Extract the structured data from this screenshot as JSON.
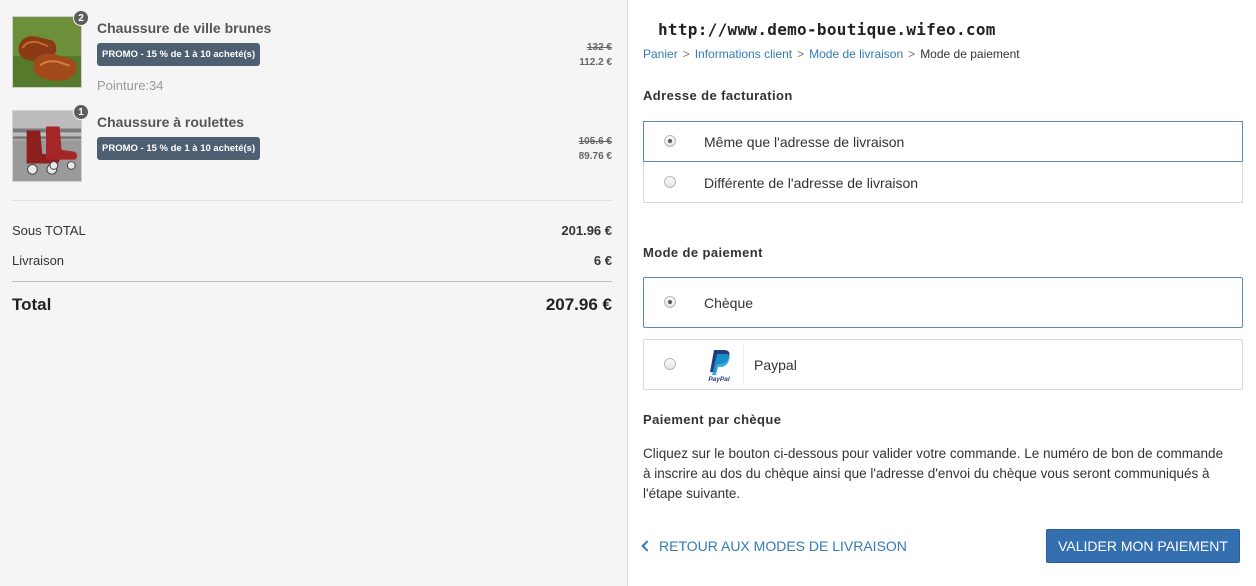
{
  "cart": {
    "items": [
      {
        "name": "Chaussure de ville brunes",
        "quantity": "2",
        "promo": "PROMO - 15 % de 1 à 10 acheté(s)",
        "size": "Pointure:34",
        "old_price": "132 €",
        "new_price": "112.2 €"
      },
      {
        "name": "Chaussure à roulettes",
        "quantity": "1",
        "promo": "PROMO - 15 % de 1 à 10 acheté(s)",
        "old_price": "105.6 €",
        "new_price": "89.76 €"
      }
    ],
    "subtotal_label": "Sous TOTAL",
    "subtotal_value": "201.96 €",
    "shipping_label": "Livraison",
    "shipping_value": "6 €",
    "total_label": "Total",
    "total_value": "207.96 €"
  },
  "header": {
    "site_url": "http://www.demo-boutique.wifeo.com"
  },
  "breadcrumb": {
    "items": [
      "Panier",
      "Informations client",
      "Mode de livraison",
      "Mode de paiement"
    ]
  },
  "billing": {
    "title": "Adresse de facturation",
    "options": [
      {
        "label": "Même que l'adresse de livraison",
        "selected": true
      },
      {
        "label": "Différente de l'adresse de livraison",
        "selected": false
      }
    ]
  },
  "payment": {
    "title": "Mode de paiement",
    "options": [
      {
        "label": "Chèque",
        "selected": true
      },
      {
        "label": "Paypal",
        "selected": false,
        "icon": "paypal-logo-icon"
      }
    ],
    "paypal_logo_text": "PayPal"
  },
  "cheque": {
    "title": "Paiement par chèque",
    "description": "Cliquez sur le bouton ci-dessous pour valider votre commande. Le numéro de bon de commande à inscrire au dos du chèque ainsi que l'adresse d'envoi du chèque vous seront communiqués à l'étape suivante."
  },
  "actions": {
    "back_label": "RETOUR AUX MODES DE LIVRAISON",
    "submit_label": "VALIDER MON PAIEMENT"
  },
  "colors": {
    "link": "#337ab7",
    "promo_badge": "#4f5f72",
    "primary_button": "#3470b0",
    "selected_border": "#5b8bb5"
  }
}
